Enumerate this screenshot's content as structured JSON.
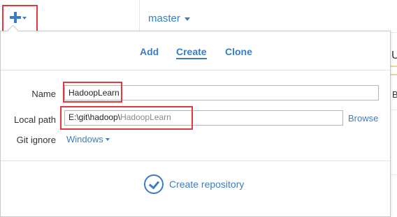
{
  "toolbar": {
    "add_icon": "plus-icon",
    "branch": "master"
  },
  "background": {
    "right_hint_1": "U",
    "right_hint_2": "B"
  },
  "popup": {
    "tabs": [
      {
        "label": "Add",
        "active": false
      },
      {
        "label": "Create",
        "active": true
      },
      {
        "label": "Clone",
        "active": false
      }
    ],
    "form": {
      "name_label": "Name",
      "name_value": "HadoopLearn",
      "path_label": "Local path",
      "path_prefix": "E:\\git\\hadoop\\",
      "path_suffix": "HadoopLearn",
      "browse_label": "Browse",
      "gitignore_label": "Git ignore",
      "gitignore_value": "Windows"
    },
    "create_button": "Create repository"
  },
  "colors": {
    "accent": "#3a7ec0",
    "highlight": "#e0393e"
  }
}
